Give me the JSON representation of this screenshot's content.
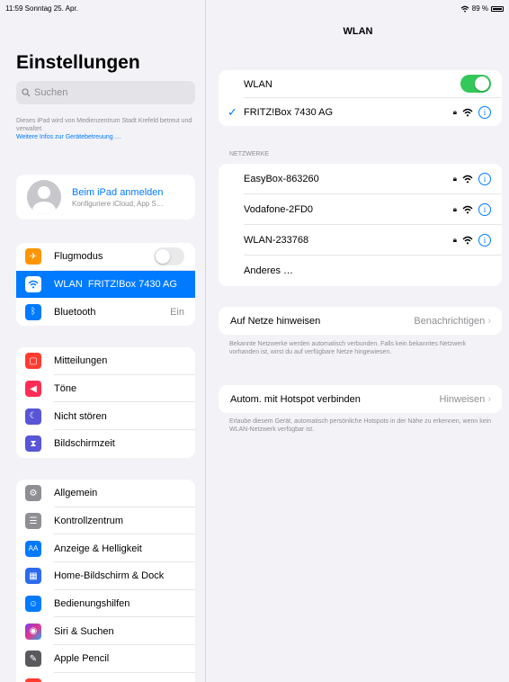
{
  "status": {
    "time": "11:59",
    "date": "Sonntag 25. Apr.",
    "battery": "89 %"
  },
  "sidebar": {
    "title": "Einstellungen",
    "search_placeholder": "Suchen",
    "managed_text": "Dieses iPad wird von Medienzentrum Stadt Krefeld betreut und verwaltet.",
    "managed_link": "Weitere Infos zur Gerätebetreuung …",
    "profile": {
      "title": "Beim iPad anmelden",
      "subtitle": "Konfiguriere iCloud, App S…"
    },
    "group1": [
      {
        "label": "Flugmodus",
        "icon": "airplane-icon",
        "color": "#ff9500",
        "toggle": false
      },
      {
        "label": "WLAN  FRITZ!Box 7430 AG",
        "icon": "wifi-icon",
        "color": "#007aff",
        "selected": true
      },
      {
        "label": "Bluetooth",
        "icon": "bluetooth-icon",
        "color": "#007aff",
        "value": "Ein"
      }
    ],
    "group2": [
      {
        "label": "Mitteilungen",
        "icon": "notifications-icon",
        "color": "#ff3b30"
      },
      {
        "label": "Töne",
        "icon": "sounds-icon",
        "color": "#ff2d55"
      },
      {
        "label": "Nicht stören",
        "icon": "moon-icon",
        "color": "#5856d6"
      },
      {
        "label": "Bildschirmzeit",
        "icon": "hourglass-icon",
        "color": "#5856d6"
      }
    ],
    "group3": [
      {
        "label": "Allgemein",
        "icon": "gear-icon",
        "color": "#8e8e93"
      },
      {
        "label": "Kontrollzentrum",
        "icon": "control-center-icon",
        "color": "#8e8e93"
      },
      {
        "label": "Anzeige & Helligkeit",
        "icon": "display-icon",
        "color": "#007aff"
      },
      {
        "label": "Home-Bildschirm & Dock",
        "icon": "homescreen-icon",
        "color": "#2c6bed"
      },
      {
        "label": "Bedienungshilfen",
        "icon": "accessibility-icon",
        "color": "#007aff"
      },
      {
        "label": "Siri & Suchen",
        "icon": "siri-icon",
        "color": "#222222"
      },
      {
        "label": "Apple Pencil",
        "icon": "pencil-icon",
        "color": "#5a5a5e"
      }
    ]
  },
  "detail": {
    "title": "WLAN",
    "wlan_label": "WLAN",
    "wlan_on": true,
    "connected": "FRITZ!Box 7430 AG",
    "networks_header": "NETZWERKE",
    "networks": [
      "EasyBox-863260",
      "Vodafone-2FD0",
      "WLAN-233768"
    ],
    "other": "Anderes …",
    "ask_label": "Auf Netze hinweisen",
    "ask_value": "Benachrichtigen",
    "ask_footer": "Bekannte Netzwerke werden automatisch verbunden. Falls kein bekanntes Netzwerk vorhanden ist, wirst du auf verfügbare Netze hingewiesen.",
    "hotspot_label": "Autom. mit Hotspot verbinden",
    "hotspot_value": "Hinweisen",
    "hotspot_footer": "Erlaube diesem Gerät, automatisch persönliche Hotspots in der Nähe zu erkennen, wenn kein WLAN-Netzwerk verfügbar ist."
  }
}
